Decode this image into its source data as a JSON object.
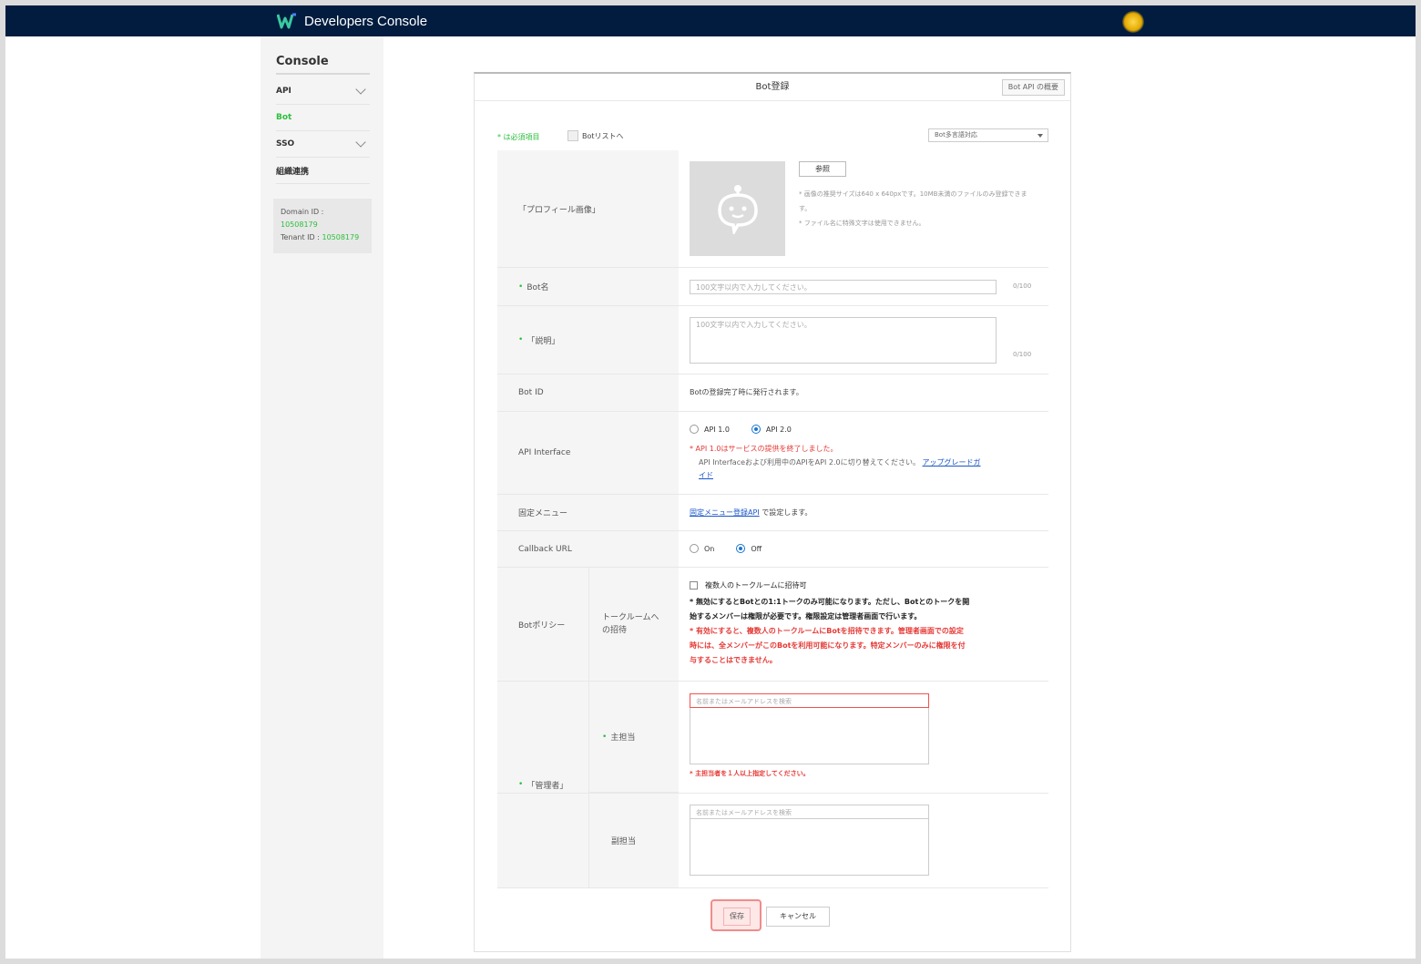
{
  "header": {
    "title": "Developers Console"
  },
  "sidebar": {
    "title": "Console",
    "items": [
      {
        "label": "API"
      },
      {
        "label": "Bot"
      },
      {
        "label": "SSO"
      },
      {
        "label": "組織連携"
      }
    ],
    "domain_label": "Domain ID :",
    "domain_value": "10508179",
    "tenant_label": "Tenant ID :",
    "tenant_value": "10508179"
  },
  "panel": {
    "title": "Bot登録",
    "overview_label": "Bot API の概要",
    "required_note": "* は必須項目",
    "list_link": "Botリストへ",
    "lang_select": "Bot多言語対応"
  },
  "form": {
    "profile": {
      "label": "「プロフィール画像」",
      "ref_button": "参照",
      "note1": "* 画像の推奨サイズは640 x 640pxです。10MB未満のファイルのみ登録できます。",
      "note2": "* ファイル名に特殊文字は使用できません。"
    },
    "bot_name": {
      "label": "Bot名",
      "placeholder": "100文字以内で入力してください。",
      "counter": "0/100"
    },
    "description": {
      "label": "「説明」",
      "placeholder": "100文字以内で入力してください。",
      "counter": "0/100"
    },
    "bot_id": {
      "label": "Bot ID",
      "value": "Botの登録完了時に発行されます。"
    },
    "api_interface": {
      "label": "API Interface",
      "option1": "API 1.0",
      "option2": "API 2.0",
      "warning": "* API 1.0はサービスの提供を終了しました。",
      "note": "API Interfaceおよび利用中のAPIをAPI 2.0に切り替えてください。",
      "link_line1": "アップグレードガ",
      "link_line2": "イド"
    },
    "fixed_menu": {
      "label": "固定メニュー",
      "link": "固定メニュー登録API",
      "suffix": " で設定します。"
    },
    "callback": {
      "label": "Callback URL",
      "on": "On",
      "off": "Off"
    },
    "policy": {
      "label": "Botポリシー",
      "sublabel_line1": "トークルームへ",
      "sublabel_line2": "の招待",
      "checkbox_label": "複数人のトークルームに招待可",
      "note1": "* 無効にするとBotとの1:1トークのみ可能になります。ただし、Botとのトークを開",
      "note2": "始するメンバーは権限が必要です。権限設定は管理者画面で行います。",
      "warn1": "* 有効にすると、複数人のトークルームにBotを招待できます。管理者画面での設定",
      "warn2": "時には、全メンバーがこのBotを利用可能になります。特定メンバーのみに権限を付",
      "warn3": "与することはできません。"
    },
    "manager": {
      "label": "「管理者」",
      "main_label": "主担当",
      "main_placeholder": "名前またはメールアドレスを検索",
      "main_warning": "* 主担当者を１人以上指定してください。",
      "sub_label": "副担当",
      "sub_placeholder": "名前またはメールアドレスを検索"
    }
  },
  "actions": {
    "save": "保存",
    "cancel": "キャンセル"
  },
  "colors": {
    "topbar": "#011c3f",
    "accent_green": "#2dbf3d",
    "warning_red": "#e53935",
    "link_blue": "#1a56c9"
  }
}
